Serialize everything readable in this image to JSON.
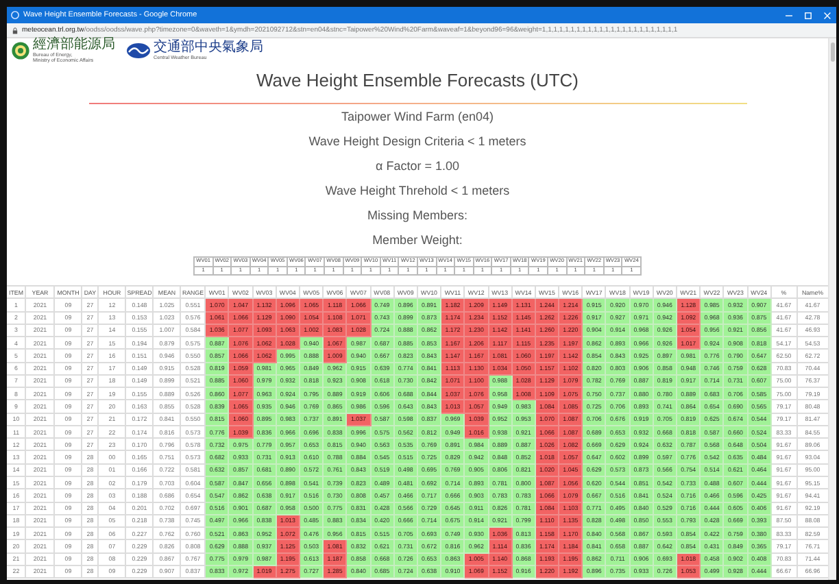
{
  "browser": {
    "title": "Wave Height Ensemble Forecasts - Google Chrome",
    "url_host": "meteocean.trl.org.tw",
    "url_path": "/oodss/oodss/wave.php?timezone=0&waveth=1&ymdh=2021092712&stn=en04&stnc=Taipower%20Wind%20Farm&waveaf=1&beyond96=96&weight=1,1,1,1,1,1,1,1,1,1,1,1,1,1,1,1,1,1,1,1,1,1,1,1"
  },
  "logos": [
    {
      "kind": "ring",
      "name_zh": "經濟部能源局",
      "name_en": [
        "Bureau of Energy,",
        "Ministry of Economic Affairs"
      ]
    },
    {
      "kind": "wave",
      "name_zh": "交通部中央氣象局",
      "name_en": [
        "Central Weather Bureau"
      ]
    }
  ],
  "heading": "Wave Height Ensemble Forecasts (UTC)",
  "info_lines": [
    "Taipower Wind Farm (en04)",
    "Wave Height Design Criteria < 1 meters",
    "α Factor = 1.00",
    "Wave Height Threhold < 1 meters",
    "Missing Members:",
    "Member Weight:"
  ],
  "member_weight": {
    "members": [
      "WV01",
      "WV02",
      "WV03",
      "WV04",
      "WV05",
      "WV06",
      "WV07",
      "WV08",
      "WV09",
      "WV10",
      "WV11",
      "WV12",
      "WV13",
      "WV14",
      "WV15",
      "WV16",
      "WV17",
      "WV18",
      "WV19",
      "WV20",
      "WV21",
      "WV22",
      "WV23",
      "WV24"
    ],
    "weights": [
      "1",
      "1",
      "1",
      "1",
      "1",
      "1",
      "1",
      "1",
      "1",
      "1",
      "1",
      "1",
      "1",
      "1",
      "1",
      "1",
      "1",
      "1",
      "1",
      "1",
      "1",
      "1",
      "1",
      "1"
    ]
  },
  "table": {
    "columns": [
      "ITEM",
      "YEAR",
      "MONTH",
      "DAY",
      "HOUR",
      "SPREAD",
      "MEAN",
      "RANGE",
      "WV01",
      "WV02",
      "WV03",
      "WV04",
      "WV05",
      "WV06",
      "WV07",
      "WV08",
      "WV09",
      "WV10",
      "WV11",
      "WV12",
      "WV13",
      "WV14",
      "WV15",
      "WV16",
      "WV17",
      "WV18",
      "WV19",
      "WV20",
      "WV21",
      "WV22",
      "WV23",
      "WV24",
      "%",
      "Name%"
    ],
    "rows": [
      {
        "cells": [
          "1",
          "2021",
          "09",
          "27",
          "12",
          "0.148",
          "1.025",
          "0.551"
        ],
        "members": [
          "1.070",
          "1.047",
          "1.132",
          "1.096",
          "1.065",
          "1.118",
          "1.066",
          "0.749",
          "0.896",
          "0.891",
          "1.182",
          "1.209",
          "1.149",
          "1.131",
          "1.244",
          "1.214",
          "0.915",
          "0.920",
          "0.970",
          "0.946",
          "1.128",
          "0.985",
          "0.932",
          "0.907"
        ],
        "exceed": [
          true,
          true,
          true,
          true,
          true,
          true,
          true,
          false,
          false,
          false,
          true,
          true,
          true,
          true,
          true,
          true,
          false,
          false,
          false,
          false,
          true,
          false,
          false,
          false
        ],
        "percent": "41.67",
        "name_percent": "41.67"
      },
      {
        "cells": [
          "2",
          "2021",
          "09",
          "27",
          "13",
          "0.153",
          "1.023",
          "0.576"
        ],
        "members": [
          "1.061",
          "1.066",
          "1.129",
          "1.090",
          "1.054",
          "1.108",
          "1.071",
          "0.743",
          "0.899",
          "0.873",
          "1.174",
          "1.234",
          "1.152",
          "1.145",
          "1.262",
          "1.226",
          "0.917",
          "0.927",
          "0.971",
          "0.942",
          "1.092",
          "0.968",
          "0.936",
          "0.875"
        ],
        "exceed": [
          true,
          true,
          true,
          true,
          true,
          true,
          true,
          false,
          false,
          false,
          true,
          true,
          true,
          true,
          true,
          true,
          false,
          false,
          false,
          false,
          true,
          false,
          false,
          false
        ],
        "percent": "41.67",
        "name_percent": "42.78"
      },
      {
        "cells": [
          "3",
          "2021",
          "09",
          "27",
          "14",
          "0.155",
          "1.007",
          "0.584"
        ],
        "members": [
          "1.036",
          "1.077",
          "1.093",
          "1.063",
          "1.002",
          "1.083",
          "1.028",
          "0.724",
          "0.888",
          "0.862",
          "1.172",
          "1.230",
          "1.142",
          "1.141",
          "1.260",
          "1.220",
          "0.904",
          "0.914",
          "0.968",
          "0.926",
          "1.054",
          "0.956",
          "0.921",
          "0.856"
        ],
        "exceed": [
          true,
          true,
          true,
          true,
          true,
          true,
          true,
          false,
          false,
          false,
          true,
          true,
          true,
          true,
          true,
          true,
          false,
          false,
          false,
          false,
          true,
          false,
          false,
          false
        ],
        "percent": "41.67",
        "name_percent": "46.93"
      },
      {
        "cells": [
          "4",
          "2021",
          "09",
          "27",
          "15",
          "0.194",
          "0.879",
          "0.575"
        ],
        "members": [
          "0.887",
          "1.076",
          "1.062",
          "1.028",
          "0.940",
          "1.067",
          "0.987",
          "0.687",
          "0.885",
          "0.853",
          "1.167",
          "1.206",
          "1.117",
          "1.115",
          "1.235",
          "1.197",
          "0.862",
          "0.893",
          "0.966",
          "0.926",
          "1.017",
          "0.924",
          "0.908",
          "0.818"
        ],
        "exceed": [
          false,
          true,
          true,
          true,
          false,
          true,
          false,
          false,
          false,
          false,
          true,
          true,
          true,
          true,
          true,
          true,
          false,
          false,
          false,
          false,
          true,
          false,
          false,
          false
        ],
        "percent": "54.17",
        "name_percent": "54.53"
      },
      {
        "cells": [
          "5",
          "2021",
          "09",
          "27",
          "16",
          "0.151",
          "0.946",
          "0.550"
        ],
        "members": [
          "0.857",
          "1.066",
          "1.062",
          "0.995",
          "0.888",
          "1.009",
          "0.940",
          "0.667",
          "0.823",
          "0.843",
          "1.147",
          "1.167",
          "1.081",
          "1.060",
          "1.197",
          "1.142",
          "0.854",
          "0.843",
          "0.925",
          "0.897",
          "0.981",
          "0.776",
          "0.790",
          "0.647"
        ],
        "exceed": [
          false,
          true,
          true,
          false,
          false,
          true,
          false,
          false,
          false,
          false,
          true,
          true,
          true,
          true,
          true,
          true,
          false,
          false,
          false,
          false,
          false,
          false,
          false,
          false
        ],
        "percent": "62.50",
        "name_percent": "62.72"
      },
      {
        "cells": [
          "6",
          "2021",
          "09",
          "27",
          "17",
          "0.149",
          "0.915",
          "0.528"
        ],
        "members": [
          "0.819",
          "1.059",
          "0.981",
          "0.965",
          "0.849",
          "0.962",
          "0.915",
          "0.639",
          "0.774",
          "0.841",
          "1.113",
          "1.130",
          "1.034",
          "1.050",
          "1.157",
          "1.102",
          "0.820",
          "0.803",
          "0.906",
          "0.858",
          "0.948",
          "0.746",
          "0.759",
          "0.628"
        ],
        "exceed": [
          false,
          true,
          false,
          false,
          false,
          false,
          false,
          false,
          false,
          false,
          true,
          true,
          true,
          true,
          true,
          true,
          false,
          false,
          false,
          false,
          false,
          false,
          false,
          false
        ],
        "percent": "70.83",
        "name_percent": "70.44"
      },
      {
        "cells": [
          "7",
          "2021",
          "09",
          "27",
          "18",
          "0.149",
          "0.899",
          "0.521"
        ],
        "members": [
          "0.885",
          "1.060",
          "0.979",
          "0.932",
          "0.818",
          "0.923",
          "0.908",
          "0.618",
          "0.730",
          "0.842",
          "1.071",
          "1.100",
          "0.988",
          "1.028",
          "1.129",
          "1.079",
          "0.782",
          "0.769",
          "0.887",
          "0.819",
          "0.917",
          "0.714",
          "0.731",
          "0.607"
        ],
        "exceed": [
          false,
          true,
          false,
          false,
          false,
          false,
          false,
          false,
          false,
          false,
          true,
          true,
          false,
          true,
          true,
          true,
          false,
          false,
          false,
          false,
          false,
          false,
          false,
          false
        ],
        "percent": "75.00",
        "name_percent": "76.37"
      },
      {
        "cells": [
          "8",
          "2021",
          "09",
          "27",
          "19",
          "0.155",
          "0.889",
          "0.526"
        ],
        "members": [
          "0.860",
          "1.077",
          "0.963",
          "0.924",
          "0.795",
          "0.889",
          "0.919",
          "0.606",
          "0.688",
          "0.844",
          "1.037",
          "1.076",
          "0.958",
          "1.008",
          "1.109",
          "1.075",
          "0.750",
          "0.737",
          "0.880",
          "0.780",
          "0.889",
          "0.683",
          "0.706",
          "0.585"
        ],
        "exceed": [
          false,
          true,
          false,
          false,
          false,
          false,
          false,
          false,
          false,
          false,
          true,
          true,
          false,
          true,
          true,
          true,
          false,
          false,
          false,
          false,
          false,
          false,
          false,
          false
        ],
        "percent": "75.00",
        "name_percent": "79.19"
      },
      {
        "cells": [
          "9",
          "2021",
          "09",
          "27",
          "20",
          "0.163",
          "0.855",
          "0.528"
        ],
        "members": [
          "0.839",
          "1.065",
          "0.935",
          "0.946",
          "0.769",
          "0.865",
          "0.986",
          "0.596",
          "0.643",
          "0.843",
          "1.013",
          "1.057",
          "0.949",
          "0.983",
          "1.084",
          "1.085",
          "0.725",
          "0.706",
          "0.893",
          "0.741",
          "0.864",
          "0.654",
          "0.690",
          "0.565"
        ],
        "exceed": [
          false,
          true,
          false,
          false,
          false,
          false,
          false,
          false,
          false,
          false,
          true,
          true,
          false,
          false,
          true,
          true,
          false,
          false,
          false,
          false,
          false,
          false,
          false,
          false
        ],
        "percent": "79.17",
        "name_percent": "80.48"
      },
      {
        "cells": [
          "10",
          "2021",
          "09",
          "27",
          "21",
          "0.172",
          "0.841",
          "0.550"
        ],
        "members": [
          "0.815",
          "1.060",
          "0.895",
          "0.983",
          "0.737",
          "0.891",
          "1.037",
          "0.587",
          "0.598",
          "0.837",
          "0.969",
          "1.039",
          "0.952",
          "0.953",
          "1.070",
          "1.087",
          "0.706",
          "0.676",
          "0.919",
          "0.705",
          "0.819",
          "0.625",
          "0.674",
          "0.544"
        ],
        "exceed": [
          false,
          true,
          false,
          false,
          false,
          false,
          true,
          false,
          false,
          false,
          false,
          true,
          false,
          false,
          true,
          true,
          false,
          false,
          false,
          false,
          false,
          false,
          false,
          false
        ],
        "percent": "79.17",
        "name_percent": "81.47"
      },
      {
        "cells": [
          "11",
          "2021",
          "09",
          "27",
          "22",
          "0.174",
          "0.816",
          "0.573"
        ],
        "members": [
          "0.776",
          "1.039",
          "0.836",
          "0.966",
          "0.696",
          "0.838",
          "0.996",
          "0.575",
          "0.562",
          "0.812",
          "0.949",
          "1.016",
          "0.938",
          "0.921",
          "1.066",
          "1.087",
          "0.689",
          "0.653",
          "0.932",
          "0.668",
          "0.818",
          "0.587",
          "0.660",
          "0.524"
        ],
        "exceed": [
          false,
          true,
          false,
          false,
          false,
          false,
          false,
          false,
          false,
          false,
          false,
          true,
          false,
          false,
          true,
          true,
          false,
          false,
          false,
          false,
          false,
          false,
          false,
          false
        ],
        "percent": "83.33",
        "name_percent": "84.55"
      },
      {
        "cells": [
          "12",
          "2021",
          "09",
          "27",
          "23",
          "0.170",
          "0.796",
          "0.578"
        ],
        "members": [
          "0.732",
          "0.975",
          "0.779",
          "0.957",
          "0.653",
          "0.815",
          "0.940",
          "0.563",
          "0.535",
          "0.769",
          "0.891",
          "0.984",
          "0.889",
          "0.887",
          "1.026",
          "1.082",
          "0.669",
          "0.629",
          "0.924",
          "0.632",
          "0.787",
          "0.568",
          "0.648",
          "0.504"
        ],
        "exceed": [
          false,
          false,
          false,
          false,
          false,
          false,
          false,
          false,
          false,
          false,
          false,
          false,
          false,
          false,
          true,
          true,
          false,
          false,
          false,
          false,
          false,
          false,
          false,
          false
        ],
        "percent": "91.67",
        "name_percent": "89.06"
      },
      {
        "cells": [
          "13",
          "2021",
          "09",
          "28",
          "00",
          "0.165",
          "0.751",
          "0.573"
        ],
        "members": [
          "0.682",
          "0.933",
          "0.731",
          "0.913",
          "0.610",
          "0.788",
          "0.884",
          "0.545",
          "0.515",
          "0.725",
          "0.829",
          "0.942",
          "0.848",
          "0.852",
          "1.018",
          "1.057",
          "0.647",
          "0.602",
          "0.899",
          "0.597",
          "0.776",
          "0.542",
          "0.635",
          "0.484"
        ],
        "exceed": [
          false,
          false,
          false,
          false,
          false,
          false,
          false,
          false,
          false,
          false,
          false,
          false,
          false,
          false,
          true,
          true,
          false,
          false,
          false,
          false,
          false,
          false,
          false,
          false
        ],
        "percent": "91.67",
        "name_percent": "93.04"
      },
      {
        "cells": [
          "14",
          "2021",
          "09",
          "28",
          "01",
          "0.166",
          "0.722",
          "0.581"
        ],
        "members": [
          "0.632",
          "0.857",
          "0.681",
          "0.890",
          "0.572",
          "0.761",
          "0.843",
          "0.519",
          "0.498",
          "0.695",
          "0.769",
          "0.905",
          "0.806",
          "0.821",
          "1.020",
          "1.045",
          "0.629",
          "0.573",
          "0.873",
          "0.566",
          "0.754",
          "0.514",
          "0.621",
          "0.464"
        ],
        "exceed": [
          false,
          false,
          false,
          false,
          false,
          false,
          false,
          false,
          false,
          false,
          false,
          false,
          false,
          false,
          true,
          true,
          false,
          false,
          false,
          false,
          false,
          false,
          false,
          false
        ],
        "percent": "91.67",
        "name_percent": "95.00"
      },
      {
        "cells": [
          "15",
          "2021",
          "09",
          "28",
          "02",
          "0.179",
          "0.703",
          "0.604"
        ],
        "members": [
          "0.587",
          "0.847",
          "0.656",
          "0.898",
          "0.541",
          "0.739",
          "0.823",
          "0.489",
          "0.481",
          "0.692",
          "0.714",
          "0.893",
          "0.781",
          "0.800",
          "1.087",
          "1.056",
          "0.620",
          "0.544",
          "0.851",
          "0.542",
          "0.733",
          "0.488",
          "0.607",
          "0.444"
        ],
        "exceed": [
          false,
          false,
          false,
          false,
          false,
          false,
          false,
          false,
          false,
          false,
          false,
          false,
          false,
          false,
          true,
          true,
          false,
          false,
          false,
          false,
          false,
          false,
          false,
          false
        ],
        "percent": "91.67",
        "name_percent": "95.15"
      },
      {
        "cells": [
          "16",
          "2021",
          "09",
          "28",
          "03",
          "0.188",
          "0.686",
          "0.654"
        ],
        "members": [
          "0.547",
          "0.862",
          "0.638",
          "0.917",
          "0.516",
          "0.730",
          "0.808",
          "0.457",
          "0.466",
          "0.717",
          "0.666",
          "0.903",
          "0.783",
          "0.783",
          "1.066",
          "1.079",
          "0.667",
          "0.516",
          "0.841",
          "0.524",
          "0.716",
          "0.466",
          "0.596",
          "0.425"
        ],
        "exceed": [
          false,
          false,
          false,
          false,
          false,
          false,
          false,
          false,
          false,
          false,
          false,
          false,
          false,
          false,
          true,
          true,
          false,
          false,
          false,
          false,
          false,
          false,
          false,
          false
        ],
        "percent": "91.67",
        "name_percent": "94.41"
      },
      {
        "cells": [
          "17",
          "2021",
          "09",
          "28",
          "04",
          "0.201",
          "0.702",
          "0.697"
        ],
        "members": [
          "0.516",
          "0.901",
          "0.687",
          "0.958",
          "0.500",
          "0.775",
          "0.831",
          "0.428",
          "0.566",
          "0.729",
          "0.645",
          "0.911",
          "0.826",
          "0.781",
          "1.084",
          "1.103",
          "0.771",
          "0.495",
          "0.840",
          "0.529",
          "0.716",
          "0.444",
          "0.605",
          "0.406"
        ],
        "exceed": [
          false,
          false,
          false,
          false,
          false,
          false,
          false,
          false,
          false,
          false,
          false,
          false,
          false,
          false,
          true,
          true,
          false,
          false,
          false,
          false,
          false,
          false,
          false,
          false
        ],
        "percent": "91.67",
        "name_percent": "92.19"
      },
      {
        "cells": [
          "18",
          "2021",
          "09",
          "28",
          "05",
          "0.218",
          "0.738",
          "0.745"
        ],
        "members": [
          "0.497",
          "0.966",
          "0.838",
          "1.013",
          "0.485",
          "0.883",
          "0.834",
          "0.420",
          "0.666",
          "0.714",
          "0.675",
          "0.914",
          "0.921",
          "0.799",
          "1.110",
          "1.135",
          "0.828",
          "0.498",
          "0.850",
          "0.553",
          "0.793",
          "0.428",
          "0.669",
          "0.393"
        ],
        "exceed": [
          false,
          false,
          false,
          true,
          false,
          false,
          false,
          false,
          false,
          false,
          false,
          false,
          false,
          false,
          true,
          true,
          false,
          false,
          false,
          false,
          false,
          false,
          false,
          false
        ],
        "percent": "87.50",
        "name_percent": "88.08"
      },
      {
        "cells": [
          "19",
          "2021",
          "09",
          "28",
          "06",
          "0.227",
          "0.762",
          "0.760"
        ],
        "members": [
          "0.521",
          "0.863",
          "0.952",
          "1.072",
          "0.476",
          "0.956",
          "0.815",
          "0.515",
          "0.705",
          "0.693",
          "0.749",
          "0.930",
          "1.036",
          "0.813",
          "1.158",
          "1.170",
          "0.840",
          "0.568",
          "0.867",
          "0.593",
          "0.854",
          "0.422",
          "0.759",
          "0.380"
        ],
        "exceed": [
          false,
          false,
          false,
          true,
          false,
          false,
          false,
          false,
          false,
          false,
          false,
          false,
          true,
          false,
          true,
          true,
          false,
          false,
          false,
          false,
          false,
          false,
          false,
          false
        ],
        "percent": "83.33",
        "name_percent": "82.59"
      },
      {
        "cells": [
          "20",
          "2021",
          "09",
          "28",
          "07",
          "0.229",
          "0.826",
          "0.808"
        ],
        "members": [
          "0.629",
          "0.888",
          "0.937",
          "1.125",
          "0.503",
          "1.081",
          "0.832",
          "0.621",
          "0.731",
          "0.672",
          "0.816",
          "0.962",
          "1.114",
          "0.836",
          "1.174",
          "1.184",
          "0.841",
          "0.658",
          "0.887",
          "0.642",
          "0.854",
          "0.431",
          "0.849",
          "0.365"
        ],
        "exceed": [
          false,
          false,
          false,
          true,
          false,
          true,
          false,
          false,
          false,
          false,
          false,
          false,
          true,
          false,
          true,
          true,
          false,
          false,
          false,
          false,
          false,
          false,
          false,
          false
        ],
        "percent": "79.17",
        "name_percent": "76.71"
      },
      {
        "cells": [
          "21",
          "2021",
          "09",
          "28",
          "08",
          "0.229",
          "0.867",
          "0.767"
        ],
        "members": [
          "0.775",
          "0.979",
          "0.987",
          "1.195",
          "0.613",
          "1.187",
          "0.858",
          "0.668",
          "0.726",
          "0.653",
          "0.863",
          "1.005",
          "1.140",
          "0.868",
          "1.193",
          "1.195",
          "0.862",
          "0.711",
          "0.906",
          "0.693",
          "1.018",
          "0.458",
          "0.902",
          "0.408"
        ],
        "exceed": [
          false,
          false,
          false,
          true,
          false,
          true,
          false,
          false,
          false,
          false,
          false,
          true,
          true,
          false,
          true,
          true,
          false,
          false,
          false,
          false,
          true,
          false,
          false,
          false
        ],
        "percent": "70.83",
        "name_percent": "71.44"
      },
      {
        "cells": [
          "22",
          "2021",
          "09",
          "28",
          "09",
          "0.229",
          "0.907",
          "0.837"
        ],
        "members": [
          "0.833",
          "0.972",
          "1.019",
          "1.275",
          "0.727",
          "1.285",
          "0.840",
          "0.685",
          "0.724",
          "0.638",
          "0.910",
          "1.069",
          "1.152",
          "0.916",
          "1.220",
          "1.192",
          "0.896",
          "0.735",
          "0.933",
          "0.726",
          "1.053",
          "0.499",
          "0.928",
          "0.444"
        ],
        "exceed": [
          false,
          false,
          true,
          true,
          false,
          true,
          false,
          false,
          false,
          false,
          false,
          true,
          true,
          false,
          true,
          true,
          false,
          false,
          false,
          false,
          true,
          false,
          false,
          false
        ],
        "percent": "66.67",
        "name_percent": "66.96"
      }
    ]
  }
}
